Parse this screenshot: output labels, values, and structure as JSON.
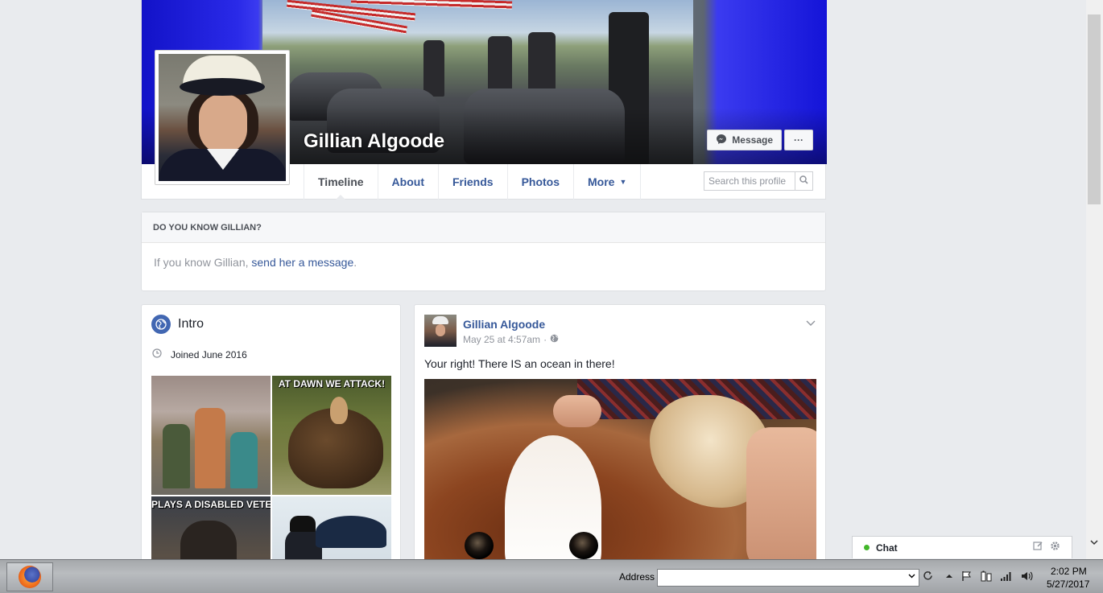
{
  "profile": {
    "name": "Gillian Algoode",
    "message_button": "Message",
    "more_button": "···"
  },
  "tabs": [
    {
      "label": "Timeline",
      "active": true
    },
    {
      "label": "About"
    },
    {
      "label": "Friends"
    },
    {
      "label": "Photos"
    },
    {
      "label": "More"
    }
  ],
  "search": {
    "placeholder": "Search this profile"
  },
  "know": {
    "title": "DO YOU KNOW GILLIAN?",
    "text_prefix": "If you know Gillian,",
    "link": "send her a message",
    "text_suffix": "."
  },
  "intro": {
    "title": "Intro",
    "joined": "Joined June 2016",
    "photo_captions": [
      "",
      "AT DAWN WE ATTACK!",
      "PLAYS A DISABLED VETERAN",
      ""
    ]
  },
  "post": {
    "author": "Gillian Algoode",
    "timestamp": "May 25 at 4:57am",
    "separator": "·",
    "text": "Your right! There IS an ocean in there!"
  },
  "chat": {
    "label": "Chat"
  },
  "taskbar": {
    "address_label": "Address",
    "address_value": "",
    "time": "2:02 PM",
    "date": "5/27/2017"
  },
  "colors": {
    "link": "#365899",
    "online": "#42b72a",
    "cover_blue": "#1a1ad8"
  }
}
